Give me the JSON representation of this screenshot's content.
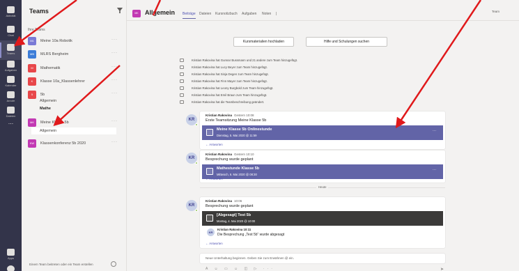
{
  "rail": {
    "items": [
      {
        "label": "Aktivität",
        "icon": "bell-icon"
      },
      {
        "label": "Chat",
        "icon": "chat-icon"
      },
      {
        "label": "Teams",
        "icon": "teams-icon"
      },
      {
        "label": "Aufgaben",
        "icon": "assignments-icon"
      },
      {
        "label": "Kalender",
        "icon": "calendar-icon"
      },
      {
        "label": "Anrufe",
        "icon": "phone-icon"
      },
      {
        "label": "Dateien",
        "icon": "files-icon"
      }
    ],
    "more": "...",
    "apps_label": "Apps",
    "help_label": "Hilfe"
  },
  "panel": {
    "title": "Teams",
    "section": "Ihre Teams",
    "teams": [
      {
        "tile": "M1",
        "name": "Meine 10a Robotik",
        "color": "#7a7ad6"
      },
      {
        "tile": "MB",
        "name": "MLRS Bergheim",
        "color": "#3d7dd8"
      },
      {
        "tile": "M",
        "name": "Mathematik",
        "color": "#e8474a"
      },
      {
        "tile": "K",
        "name": "Klasse 10a_Klassenlehrer",
        "color": "#e8474a"
      },
      {
        "tile": "5",
        "name": "5b",
        "color": "#e8474a"
      },
      {
        "tile": "MK",
        "name": "Meine Klasse 5b",
        "color": "#c239b3"
      },
      {
        "tile": "KW",
        "name": "Klassenkonferenz 5b 2020",
        "color": "#c239b3"
      }
    ],
    "channels_5b": [
      "Allgemein",
      "Mathe"
    ],
    "channel_selected": "Allgemein",
    "more": "···",
    "join": "Einem Team beitreten oder ein Team erstellen"
  },
  "header": {
    "tile": "MK",
    "title": "Allgemein",
    "tabs": [
      "Beiträge",
      "Dateien",
      "Kursnotizbuch",
      "Aufgaben",
      "Noten"
    ],
    "team_button": "Team"
  },
  "feed": {
    "buttons": [
      "Kursmaterialien hochladen",
      "Hilfe und Schulungen suchen"
    ],
    "system_messages": [
      "Kristian Rakovina hat Gunnar Bussmann und 21 andere zum Team hinzugefügt.",
      "Kristian Rakovina hat Lucy Beyer zum Team hinzugefügt.",
      "Kristian Rakovina hat Sinja Degen zum Team hinzugefügt.",
      "Kristian Rakovina hat Finn Mayer zum Team hinzugefügt.",
      "Kristian Rakovina hat Leony Burgbold zum Team hinzugefügt.",
      "Kristian Rakovina hat Emil Braun zum Team hinzugefügt.",
      "Kristian Rakovina hat die Teambeschreibung geändert."
    ],
    "messages": [
      {
        "avatar": "KR",
        "author": "Kristian Rakovina",
        "time": "Gestern 10:08",
        "text": "Erste Teamsitzung Meine Klasse 5b",
        "card_title": "Meine Klasse 5b Onlinestunde",
        "card_date": "Dienstag, 5. Mai 2020 @ 11:59",
        "card_color": "#6264a7",
        "reply": "← Antworten"
      },
      {
        "avatar": "KR",
        "author": "Kristian Rakovina",
        "time": "Gestern 10:10",
        "text": "Besprechung wurde geplant",
        "card_title": "Mathestunde Klasse 5b",
        "card_date": "Mittwoch, 6. Mai 2020 @ 08:30",
        "card_color": "#6264a7",
        "reply": "← Antworten"
      },
      {
        "avatar": "KR",
        "author": "Kristian Rakovina",
        "time": "10:06",
        "text": "Besprechung wurde geplant",
        "card_title": "[Abgesagt] Test 5b",
        "card_date": "Montag, 4. Mai 2020 @ 10:00",
        "card_color": "#3b3a39",
        "sub_avatar": "KR",
        "sub_author": "Kristian Rakovina  10:11",
        "sub_text": "Die Besprechung „Test 5b“ wurde abgesagt",
        "reply": "← Antworten"
      }
    ],
    "divider": "Heute",
    "compose_placeholder": "Neue Unterhaltung beginnen. Geben Sie zum Erwähnen @ ein.",
    "compose_tools": "A ☺ ▭ ☺ ◫ ▷ ···",
    "send": "➤"
  }
}
